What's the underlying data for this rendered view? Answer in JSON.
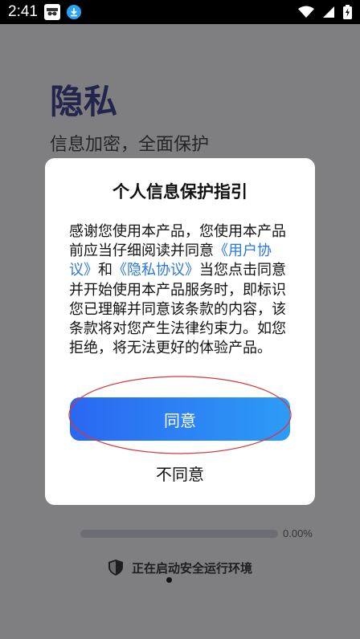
{
  "status_bar": {
    "time": "2:41"
  },
  "background": {
    "title": "隐私",
    "subtitle": "信息加密，全面保护",
    "progress_text": "0.00%",
    "progress_fraction": 0,
    "boot_text": "正在启动安全运行环境"
  },
  "dialog": {
    "title": "个人信息保护指引",
    "body_intro": "感谢您使用本产品，您使用本产品前应当仔细阅读并同意",
    "link_user": "《用户协议》",
    "and_word": "和",
    "link_privacy": "《隐私协议》",
    "body_rest": "当您点击同意并开始使用本产品服务时，即标识您已理解并同意该条款的内容，该条款将对您产生法律约束力。如您拒绝，将无法更好的体验产品。",
    "agree_label": "同意",
    "disagree_label": "不同意"
  },
  "colors": {
    "link": "#2a77e0",
    "button_start": "#2a67f2",
    "button_end": "#2d9cf5",
    "annotation": "#d63a3a"
  }
}
